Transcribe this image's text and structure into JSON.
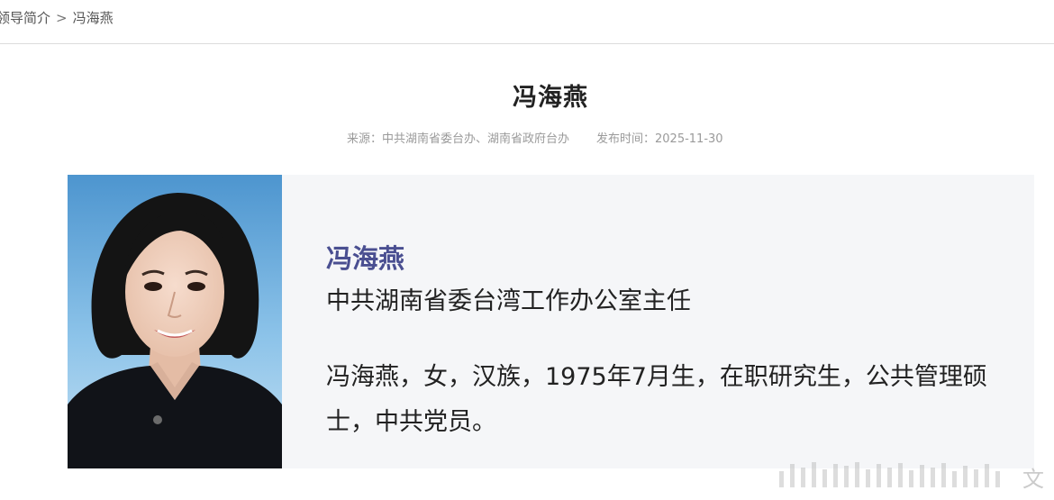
{
  "breadcrumb": {
    "parent": "领导简介",
    "separator": ">",
    "current": "冯海燕"
  },
  "article": {
    "title": "冯海燕",
    "source_label": "来源：中共湖南省委台办、湖南省政府台办",
    "published_label": "发布时间：2025-11-30"
  },
  "profile": {
    "name": "冯海燕",
    "position": "中共湖南省委台湾工作办公室主任",
    "bio": "冯海燕，女，汉族，1975年7月生，在职研究生，公共管理硕士，中共党员。"
  },
  "colors": {
    "name_accent": "#4a4f91",
    "card_background": "#f5f6f8",
    "photo_background": "#6aa9d8"
  },
  "watermark": {
    "glyph": "文"
  }
}
